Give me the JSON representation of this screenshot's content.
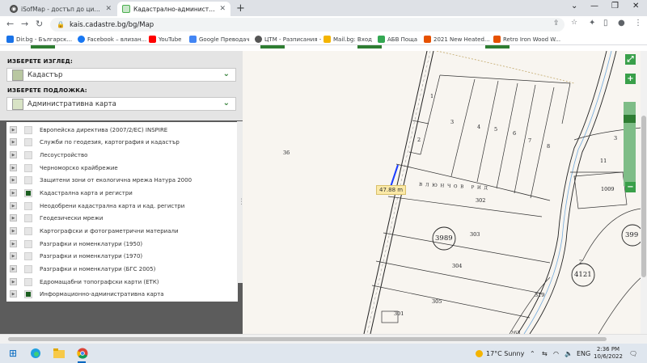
{
  "browser": {
    "tabs": [
      {
        "title": "iSofMap - достъп до цифрови д",
        "active": false
      },
      {
        "title": "Кадастрално-административна",
        "active": true
      }
    ],
    "url": "kais.cadastre.bg/bg/Map",
    "bookmarks": [
      {
        "label": "Dir.bg - Българск...",
        "color": "#1a73e8"
      },
      {
        "label": "Facebook – влизан...",
        "color": "#1877f2"
      },
      {
        "label": "YouTube",
        "color": "#ff0000"
      },
      {
        "label": "Google Преводач",
        "color": "#4285f4"
      },
      {
        "label": "ЦТМ - Разписания -",
        "color": "#555555"
      },
      {
        "label": "Mail.bg: Вход",
        "color": "#f4b400"
      },
      {
        "label": "АБВ Поща",
        "color": "#34a853"
      },
      {
        "label": "2021 New Heated...",
        "color": "#e65100"
      },
      {
        "label": "Retro Iron Wood W...",
        "color": "#e65100"
      }
    ]
  },
  "sidebar": {
    "view_label": "ИЗБЕРЕТЕ ИЗГЛЕД:",
    "view_value": "Кадастър",
    "base_label": "ИЗБЕРЕТЕ ПОДЛОЖКА:",
    "base_value": "Административна карта",
    "layers": [
      {
        "label": "Европейска директива (2007/2/EC) INSPIRE",
        "checked": false
      },
      {
        "label": "Служби по геодезия, картография и кадастър",
        "checked": false
      },
      {
        "label": "Лесоустройство",
        "checked": false
      },
      {
        "label": "Черноморско крайбрежие",
        "checked": false
      },
      {
        "label": "Защитени зони от екологична мрежа Натура 2000",
        "checked": false
      },
      {
        "label": "Кадастрална карта и регистри",
        "checked": true
      },
      {
        "label": "Неодобрени кадастрална карта и кад. регистри",
        "checked": false
      },
      {
        "label": "Геодезически мрежи",
        "checked": false
      },
      {
        "label": "Картографски и фотограметрични материали",
        "checked": false
      },
      {
        "label": "Разграфки и номенклатури (1950)",
        "checked": false
      },
      {
        "label": "Разграфки и номенклатури (1970)",
        "checked": false
      },
      {
        "label": "Разграфки и номенклатури (БГС 2005)",
        "checked": false
      },
      {
        "label": "Едромащабни топографски карти (ЕТК)",
        "checked": false
      },
      {
        "label": "Информационно-административна карта",
        "checked": true
      }
    ]
  },
  "map": {
    "measure_label": "47.88 m",
    "locality_label": "В Л Ю Н Ч О В   Р И Д",
    "parcel_labels": [
      "36",
      "1",
      "2",
      "3",
      "4",
      "5",
      "6",
      "7",
      "8",
      "302",
      "303",
      "304",
      "305",
      "301",
      "263",
      "319",
      "2",
      "11",
      "1009",
      "3"
    ],
    "circled_labels": [
      "3989",
      "4121",
      "399"
    ]
  },
  "taskbar": {
    "weather": "17°C  Sunny",
    "language": "ENG",
    "time": "2:36 PM",
    "date": "10/6/2022"
  }
}
